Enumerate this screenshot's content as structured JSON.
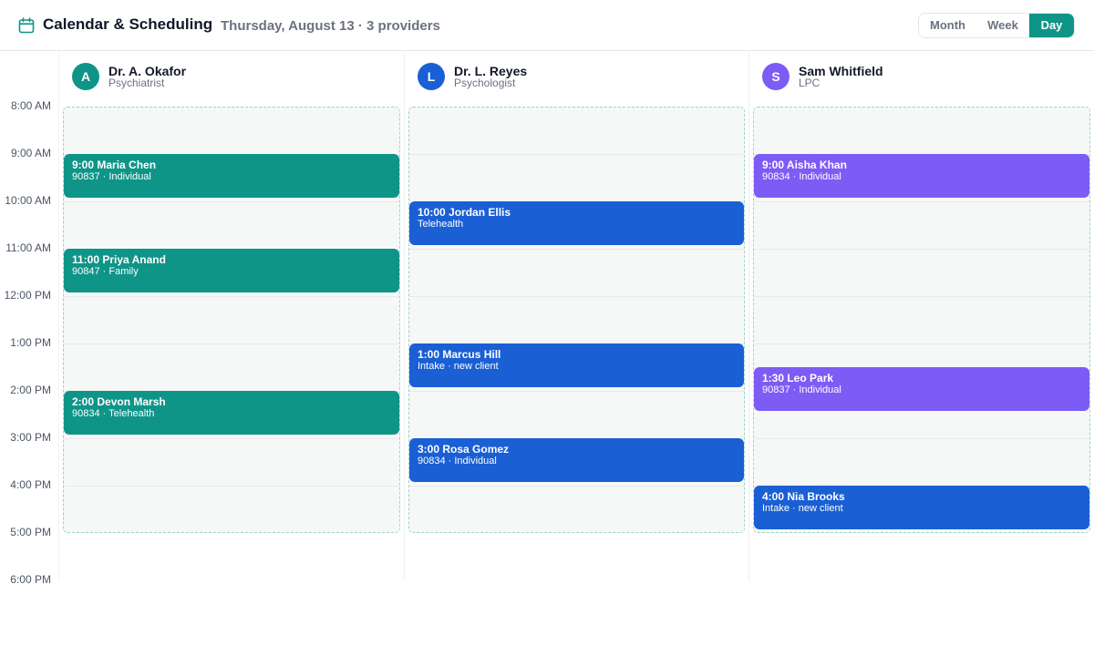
{
  "header": {
    "title": "Calendar & Scheduling",
    "subtitle": "Thursday, August 13 · 3 providers",
    "icon": "calendar-icon",
    "views": [
      "Month",
      "Week",
      "Day"
    ],
    "active_view": "Day"
  },
  "colors": {
    "accent": "#0f9488",
    "blue": "#1a5fd4",
    "purple": "#7c5cf5"
  },
  "hours": [
    "8:00 AM",
    "9:00 AM",
    "10:00 AM",
    "11:00 AM",
    "12:00 PM",
    "1:00 PM",
    "2:00 PM",
    "3:00 PM",
    "4:00 PM",
    "5:00 PM",
    "6:00 PM"
  ],
  "providers": [
    {
      "initial": "A",
      "name": "Dr. A. Okafor",
      "role": "Psychiatrist",
      "appointments": [
        {
          "title": "9:00 Maria Chen",
          "detail": "90837 · Individual"
        },
        {
          "title": "11:00 Priya Anand",
          "detail": "90847 · Family"
        },
        {
          "title": "2:00 Devon Marsh",
          "detail": "90834 · Telehealth"
        }
      ]
    },
    {
      "initial": "L",
      "name": "Dr. L. Reyes",
      "role": "Psychologist",
      "appointments": [
        {
          "title": "10:00 Jordan Ellis",
          "detail": "Telehealth"
        },
        {
          "title": "1:00 Marcus Hill",
          "detail": "Intake · new client"
        },
        {
          "title": "3:00 Rosa Gomez",
          "detail": "90834 · Individual"
        }
      ]
    },
    {
      "initial": "S",
      "name": "Sam Whitfield",
      "role": "LPC",
      "appointments": [
        {
          "title": "9:00 Aisha Khan",
          "detail": "90834 · Individual"
        },
        {
          "title": "1:30 Leo Park",
          "detail": "90837 · Individual"
        },
        {
          "title": "4:00 Nia Brooks",
          "detail": "Intake · new client"
        }
      ]
    }
  ]
}
